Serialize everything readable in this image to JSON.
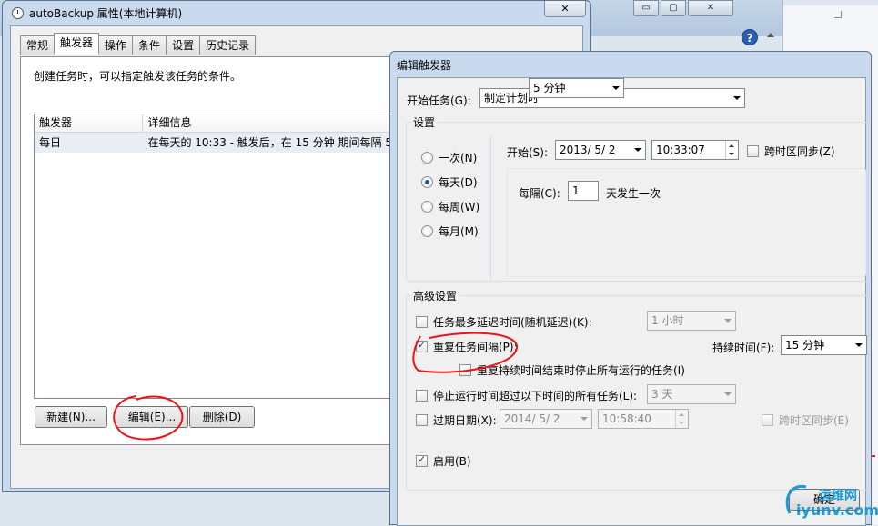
{
  "background": {
    "window_buttons": [
      "▭",
      "▢",
      "✕"
    ],
    "help_icon": "?"
  },
  "properties_window": {
    "title": "autoBackup 属性(本地计算机)",
    "close_glyph": "✕",
    "tabs": [
      {
        "label": "常规",
        "active": false
      },
      {
        "label": "触发器",
        "active": true
      },
      {
        "label": "操作",
        "active": false
      },
      {
        "label": "条件",
        "active": false
      },
      {
        "label": "设置",
        "active": false
      },
      {
        "label": "历史记录",
        "active": false
      }
    ],
    "description": "创建任务时，可以指定触发该任务的条件。",
    "trigger_list": {
      "columns": [
        "触发器",
        "详细信息"
      ],
      "rows": [
        {
          "trigger": "每日",
          "details": "在每天的 10:33 - 触发后，在 15 分钟 期间每隔 5"
        }
      ]
    },
    "buttons": {
      "new": "新建(N)...",
      "edit": "编辑(E)...",
      "delete": "删除(D)"
    }
  },
  "edit_dialog": {
    "title": "编辑触发器",
    "begin_task_label": "开始任务(G):",
    "begin_task_value": "制定计划时",
    "settings_label": "设置",
    "schedule_options": [
      {
        "label": "一次(N)",
        "selected": false
      },
      {
        "label": "每天(D)",
        "selected": true
      },
      {
        "label": "每周(W)",
        "selected": false
      },
      {
        "label": "每月(M)",
        "selected": false
      }
    ],
    "start_label": "开始(S):",
    "start_date": "2013/ 5/ 2",
    "start_time": "10:33:07",
    "sync_timezone_label": "跨时区同步(Z)",
    "every_label": "每隔(C):",
    "every_value": "1",
    "every_unit": "天发生一次",
    "advanced_label": "高级设置",
    "delay": {
      "label": "任务最多延迟时间(随机延迟)(K):",
      "checked": false,
      "value": "1 小时"
    },
    "repeat": {
      "label": "重复任务间隔(P):",
      "checked": true,
      "value": "5 分钟",
      "duration_label": "持续时间(F):",
      "duration_value": "15 分钟"
    },
    "stop_running": {
      "label": "重复持续时间结束时停止所有运行的任务(I)",
      "checked": false
    },
    "stop_longer": {
      "label": "停止运行时间超过以下时间的所有任务(L):",
      "checked": false,
      "value": "3 天"
    },
    "expire": {
      "label": "过期日期(X):",
      "checked": false,
      "date": "2014/ 5/ 2",
      "time": "10:58:40",
      "sync_label": "跨时区同步(E)"
    },
    "enabled": {
      "label": "启用(B)",
      "checked": true
    },
    "ok_label": "确定"
  },
  "watermark": {
    "line1": "运维网",
    "line2": "iyunv.com",
    "color": "#1a9ad6"
  },
  "annotation_color": "#e8141b"
}
